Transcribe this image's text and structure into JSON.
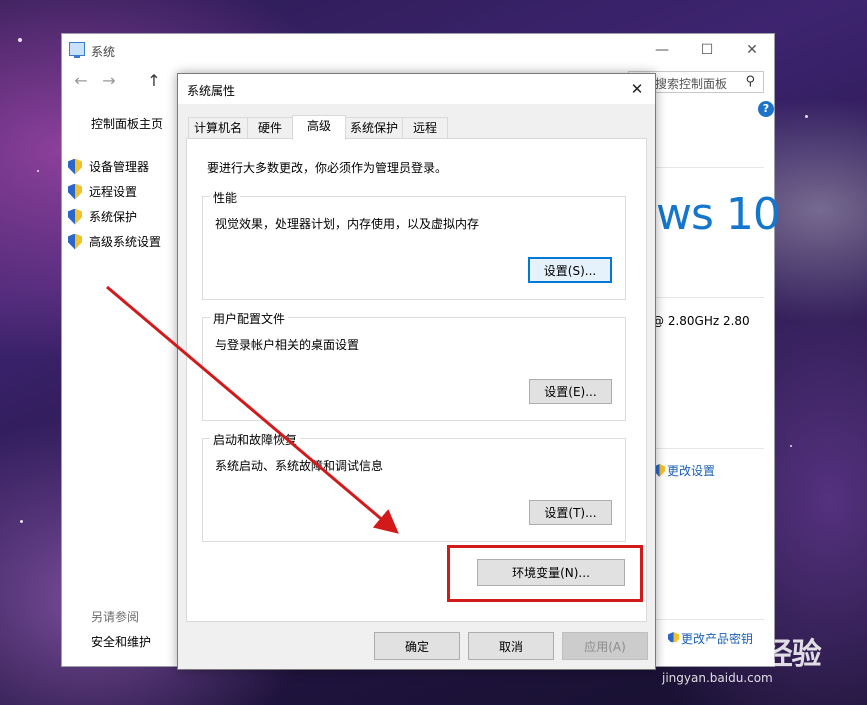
{
  "colors": {
    "accent": "#0078d7",
    "link": "#1a5fb4",
    "arrow": "#d31a1a",
    "win10_blue": "#1476cc"
  },
  "system_window": {
    "title": "系统",
    "minimize": "—",
    "maximize": "☐",
    "close": "✕",
    "nav": {
      "back": "←",
      "forward": "→",
      "up": "↑"
    },
    "search_placeholder": "搜索控制面板",
    "search_icon": "⚲",
    "help": "?",
    "sidebar": {
      "home": "控制面板主页",
      "items": [
        {
          "label": "设备管理器",
          "icon": "shield-icon"
        },
        {
          "label": "远程设置",
          "icon": "shield-icon"
        },
        {
          "label": "系统保护",
          "icon": "shield-icon"
        },
        {
          "label": "高级系统设置",
          "icon": "shield-icon"
        }
      ]
    },
    "see_also": "另请参阅",
    "security_maintenance": "安全和维护",
    "windows_brand": "ws 10",
    "cpu_info": "@ 2.80GHz   2.80",
    "change_settings": "更改设置",
    "change_product_key": "更改产品密钥"
  },
  "dialog": {
    "title": "系统属性",
    "close": "✕",
    "tabs": [
      {
        "label": "计算机名"
      },
      {
        "label": "硬件"
      },
      {
        "label": "高级"
      },
      {
        "label": "系统保护"
      },
      {
        "label": "远程"
      }
    ],
    "active_tab": "高级",
    "admin_note": "要进行大多数更改，你必须作为管理员登录。",
    "groups": {
      "performance": {
        "label": "性能",
        "description": "视觉效果，处理器计划，内存使用，以及虚拟内存",
        "button": "设置(S)..."
      },
      "user_profiles": {
        "label": "用户配置文件",
        "description": "与登录帐户相关的桌面设置",
        "button": "设置(E)..."
      },
      "startup_recovery": {
        "label": "启动和故障恢复",
        "description": "系统启动、系统故障和调试信息",
        "button": "设置(T)..."
      }
    },
    "env_button": "环境变量(N)...",
    "ok": "确定",
    "cancel": "取消",
    "apply": "应用(A)"
  },
  "watermark": {
    "logo": "Baidu 经验",
    "url": "jingyan.baidu.com"
  }
}
